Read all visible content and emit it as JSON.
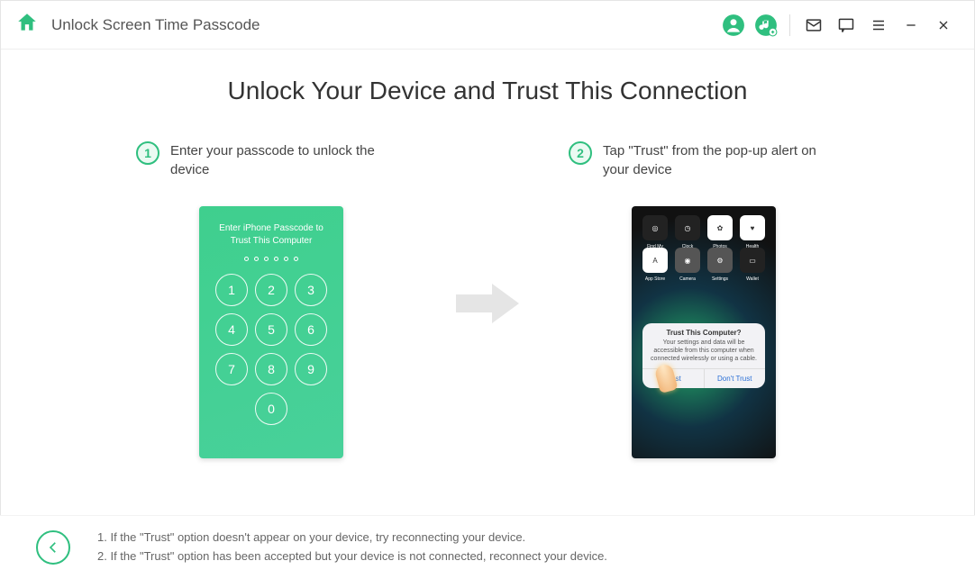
{
  "header": {
    "title": "Unlock Screen Time Passcode"
  },
  "main": {
    "heading": "Unlock Your Device and Trust This Connection",
    "step1_num": "1",
    "step1_text": "Enter your passcode to unlock the device",
    "step2_num": "2",
    "step2_text": "Tap \"Trust\" from the pop-up alert on your device"
  },
  "passcode_mock": {
    "title": "Enter iPhone Passcode to Trust This Computer",
    "keys": [
      "1",
      "2",
      "3",
      "4",
      "5",
      "6",
      "7",
      "8",
      "9",
      "0"
    ]
  },
  "trust_mock": {
    "apps": [
      {
        "label": "Find My",
        "cls": "dark",
        "glyph": "◎"
      },
      {
        "label": "Clock",
        "cls": "dark",
        "glyph": "◷"
      },
      {
        "label": "Photos",
        "cls": "",
        "glyph": "✿"
      },
      {
        "label": "Health",
        "cls": "",
        "glyph": "♥"
      },
      {
        "label": "App Store",
        "cls": "",
        "glyph": "A"
      },
      {
        "label": "Camera",
        "cls": "gray",
        "glyph": "◉"
      },
      {
        "label": "Settings",
        "cls": "gray",
        "glyph": "⚙"
      },
      {
        "label": "Wallet",
        "cls": "dark",
        "glyph": "▭"
      }
    ],
    "alert_title": "Trust This Computer?",
    "alert_body": "Your settings and data will be accessible from this computer when connected wirelessly or using a cable.",
    "trust_label": "Trust",
    "dont_trust_label": "Don't Trust"
  },
  "footer": {
    "note1": "1. If the \"Trust\" option doesn't appear on your device, try reconnecting your device.",
    "note2": "2. If the \"Trust\" option has been accepted but your device is not connected, reconnect your device."
  }
}
